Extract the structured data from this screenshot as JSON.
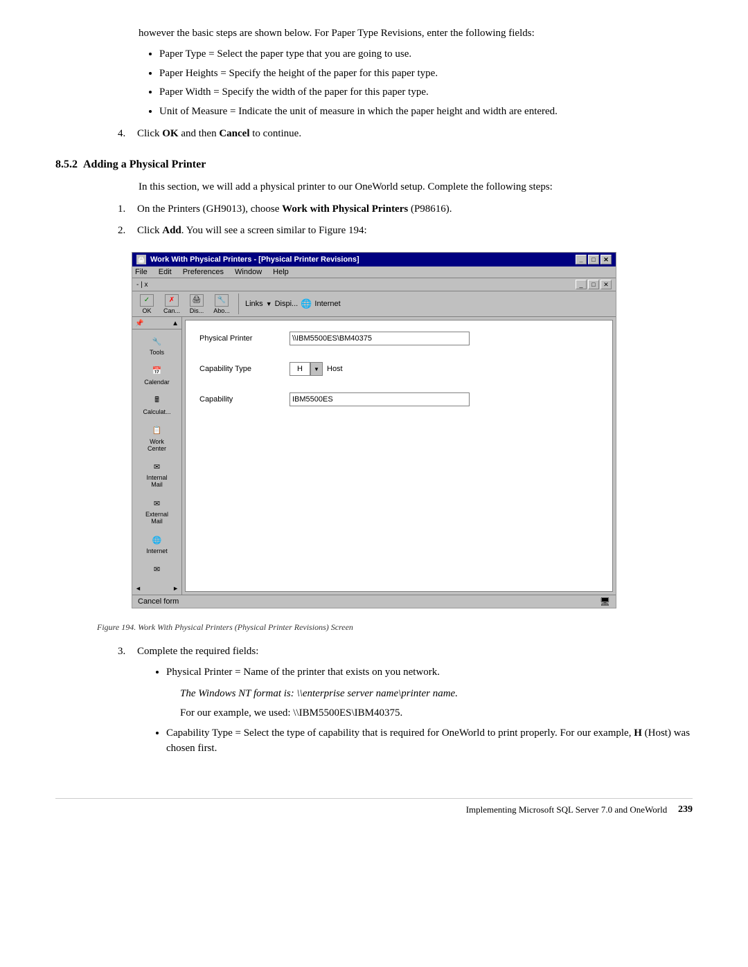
{
  "intro": {
    "text1": "however the basic steps are shown below. For Paper Type Revisions, enter the following fields:",
    "bullets": [
      "Paper Type = Select the paper type that you are going to use.",
      "Paper Heights = Specify the height of the paper for this paper type.",
      "Paper Width = Specify the width of the paper for this paper type.",
      "Unit of Measure = Indicate the unit of measure in which the paper height and width are entered."
    ],
    "step4": "Click",
    "step4_bold1": "OK",
    "step4_mid": "and then",
    "step4_bold2": "Cancel",
    "step4_end": "to continue."
  },
  "section": {
    "number": "8.5.2",
    "title": "Adding a Physical Printer",
    "intro": "In this section, we will add a physical printer to our OneWorld setup. Complete the following steps:",
    "step1_pre": "On the Printers (GH9013), choose",
    "step1_bold": "Work with Physical Printers",
    "step1_post": "(P98616).",
    "step2_pre": "Click",
    "step2_bold": "Add",
    "step2_post": ". You will see a screen similar to Figure 194:"
  },
  "screenshot": {
    "titlebar": "Work With Physical Printers  - [Physical Printer Revisions]",
    "menubar_items": [
      "File",
      "Edit",
      "Preferences",
      "Window",
      "Help"
    ],
    "inner_title": "- | x",
    "toolbar_buttons": [
      {
        "icon": "✓",
        "label": "OK"
      },
      {
        "icon": "✗",
        "label": "Can..."
      },
      {
        "icon": "🖨",
        "label": "Dis..."
      },
      {
        "icon": "🔧",
        "label": "Abo..."
      }
    ],
    "toolbar_links": "Links",
    "toolbar_dispi": "Dispi...",
    "toolbar_internet": "Internet",
    "sidebar_label_tools": "Tools",
    "sidebar_items": [
      {
        "icon": "📅",
        "label": "Calendar"
      },
      {
        "icon": "🖩",
        "label": "Calculat..."
      },
      {
        "icon": "🗂",
        "label": "Work\nCenter"
      },
      {
        "icon": "✉",
        "label": "Internal\nMail"
      },
      {
        "icon": "✉",
        "label": "External\nMail"
      },
      {
        "icon": "🌐",
        "label": "Internet"
      }
    ],
    "form_fields": [
      {
        "label": "Physical Printer",
        "value": "\\\\IBM5500ES\\BM40375"
      },
      {
        "label": "Capability Type",
        "value": "H",
        "extra": "Host"
      },
      {
        "label": "Capability",
        "value": "IBM5500ES"
      }
    ],
    "statusbar": "Cancel form"
  },
  "figure_caption": "Figure 194.  Work With Physical Printers (Physical Printer Revisions) Screen",
  "after_steps": {
    "step3": "Complete the required fields:",
    "bullets": [
      "Physical Printer = Name of the printer that exists on you network."
    ],
    "indent1": "The Windows NT format is: \\\\enterprise server name\\printer name.",
    "indent2": "For our example, we used: \\\\IBM5500ES\\IBM40375.",
    "bullet2_pre": "Capability Type = Select the type of capability that is required for OneWorld to print properly. For our example,",
    "bullet2_bold": "H",
    "bullet2_post": "(Host) was chosen first."
  },
  "footer": {
    "text": "Implementing Microsoft SQL Server 7.0 and OneWorld",
    "page": "239"
  }
}
